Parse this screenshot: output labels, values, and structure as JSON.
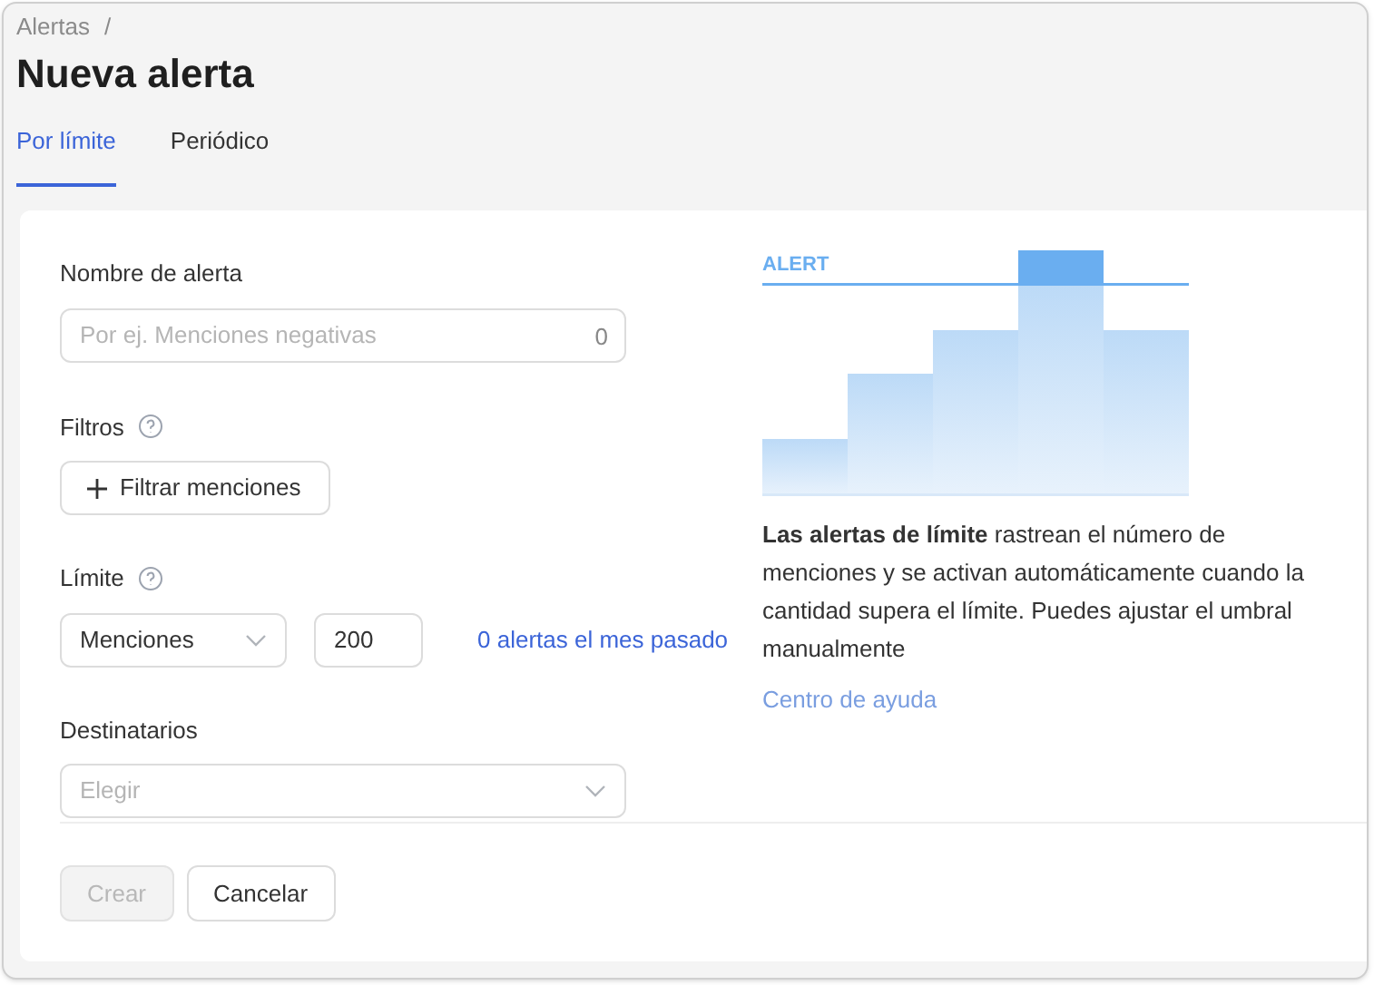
{
  "breadcrumb": {
    "items": [
      "Alertas"
    ],
    "separator": "/"
  },
  "title": "Nueva alerta",
  "tabs": [
    {
      "label": "Por límite",
      "selected": true
    },
    {
      "label": "Periódico",
      "selected": false
    }
  ],
  "form": {
    "name_field": {
      "label": "Nombre de alerta",
      "placeholder": "Por ej. Menciones negativas",
      "counter": "0"
    },
    "filters": {
      "label": "Filtros",
      "button": "Filtrar menciones"
    },
    "limit": {
      "label": "Límite",
      "select_value": "Menciones",
      "amount": "200",
      "link": "0 alertas el mes pasado"
    },
    "recipients": {
      "label": "Destinatarios",
      "placeholder": "Elegir"
    }
  },
  "illustration": {
    "label": "ALERT"
  },
  "description": "**Las alertas de límite** rastrean el número de menciones y se activan automáticamente cuando la cantidad supera el límite. Puedes ajustar el umbral manualmente",
  "help_link": "Centro de ayuda",
  "buttons": [
    {
      "label": "Crear",
      "disabled": true
    },
    {
      "label": "Cancelar",
      "disabled": false
    }
  ]
}
